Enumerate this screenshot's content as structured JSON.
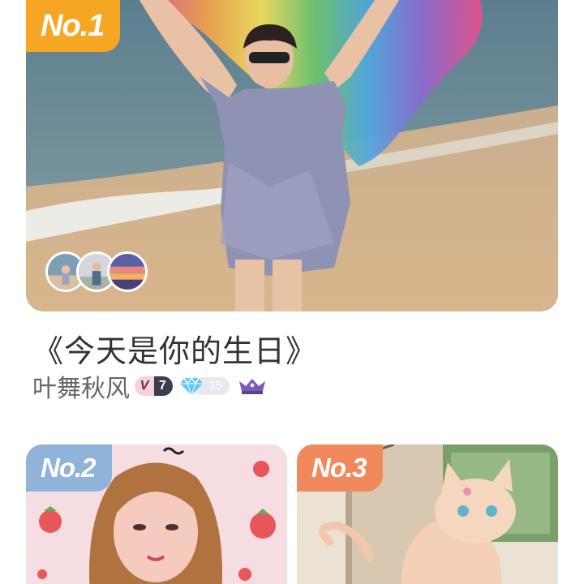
{
  "featured": {
    "rank": "No.1",
    "title": "《今天是你的生日》",
    "author": "叶舞秋风",
    "badges": {
      "v_letter": "V",
      "v_level": "7",
      "diamond_level": "35"
    },
    "avatar_icons": [
      "beach-avatar-icon",
      "person-avatar-icon",
      "sunset-avatar-icon"
    ]
  },
  "cards": [
    {
      "rank": "No.2"
    },
    {
      "rank": "No.3"
    }
  ],
  "colors": {
    "rank_1": "#f5a623",
    "rank_2": "#8fb3d9",
    "rank_3": "#f08a5c",
    "title_text": "#333333",
    "author_text": "#666666"
  }
}
